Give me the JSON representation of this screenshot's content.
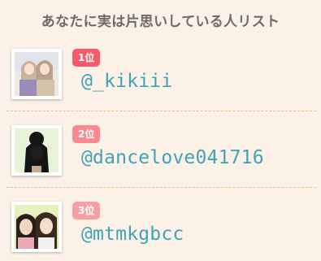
{
  "page": {
    "title": "あなたに実は片思いしている人リスト"
  },
  "ranking": [
    {
      "rank_label": "1位",
      "username": "@_kikiii",
      "badge_color": "#f45b6a"
    },
    {
      "rank_label": "2位",
      "username": "@dancelove041716",
      "badge_color": "#f68a8f"
    },
    {
      "rank_label": "3位",
      "username": "@mtmkgbcc",
      "badge_color": "#f6a0a3"
    }
  ],
  "colors": {
    "background": "#fbf1e6",
    "username": "#3fa3b6",
    "divider": "#e9c27b",
    "title": "#6f6a66"
  }
}
